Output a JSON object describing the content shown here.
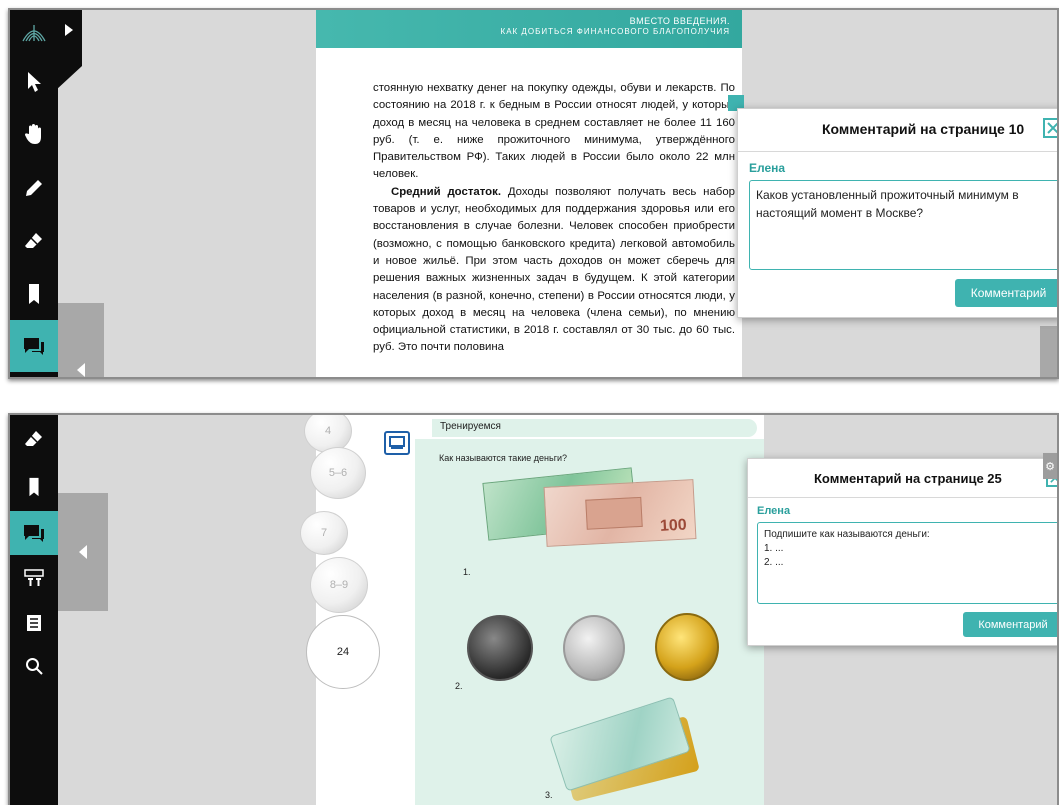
{
  "panel1": {
    "page_header": {
      "line1": "ВМЕСТО ВВЕДЕНИЯ.",
      "line2": "КАК ДОБИТЬСЯ ФИНАНСОВОГО БЛАГОПОЛУЧИЯ"
    },
    "text": {
      "p1": "стоянную нехватку денег на покупку одежды, обуви и лекарств. По состоянию на 2018 г. к бедным в России относят людей, у которых доход в месяц на человека в среднем составляет не более 11 160 руб. (т. е. ниже прожиточного минимума, утверждённого Правительством РФ). Таких людей в России было около 22 млн человек.",
      "p2_bold": "Средний достаток.",
      "p2_rest": " Доходы позволяют получать весь набор товаров и услуг, необходимых для поддержания здоровья или его восстановления в случае болезни. Человек способен приобрести (возможно, с помощью банковского кредита) легковой автомобиль и новое жильё. При этом часть доходов он может сберечь для решения важных жизненных задач в будущем. К этой категории населения (в разной, конечно, степени) в России относятся люди, у которых доход в месяц на человека (члена семьи), по мнению официальной статистики, в 2018 г. составлял от 30 тыс. до 60 тыс. руб. Это почти половина"
    },
    "comment": {
      "title": "Комментарий на странице 10",
      "author": "Елена",
      "text": "Каков установленный прожиточный минимум в настоящий момент в Москве?",
      "button": "Комментарий"
    }
  },
  "panel2": {
    "page_nav": [
      "4",
      "5–6",
      "7",
      "8–9",
      "24"
    ],
    "heading": "Тренируемся",
    "question": "Как называются такие деньги?",
    "items": [
      "1.",
      "2.",
      "3."
    ],
    "banknote_value": "100",
    "comment": {
      "title": "Комментарий на странице 25",
      "author": "Елена",
      "text": "Подпишите как называются деньги:\n1. ...\n2. ...",
      "button": "Комментарий"
    }
  },
  "icons": {
    "toolbar_top": [
      "logo-icon",
      "pointer-icon",
      "hand-icon",
      "pencil-icon",
      "eraser-icon",
      "bookmark-icon",
      "comment-icon"
    ],
    "toolbar_bottom": [
      "eraser-icon",
      "bookmark-icon",
      "comment-icon",
      "media-icon",
      "contents-icon",
      "search-icon"
    ]
  },
  "colors": {
    "accent": "#3fb3b0",
    "toolbar": "#0d0d0d",
    "background": "#d9d9d9",
    "author": "#2a9f9c",
    "monitor": "#1e5fa8"
  }
}
